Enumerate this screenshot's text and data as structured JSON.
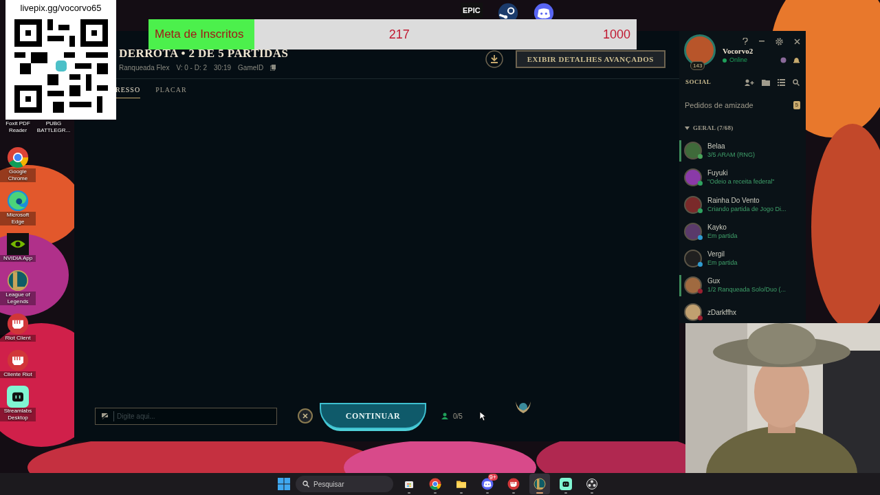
{
  "desktop_icons": [
    {
      "label": "Foxit PDF Reader"
    },
    {
      "label": "PUBG BATTLEGR..."
    },
    {
      "label": "Google Chrome",
      "kind": "chrome"
    },
    {
      "label": "Microsoft Edge",
      "kind": "edge"
    },
    {
      "label": "NVIDIA App",
      "kind": "nvidia"
    },
    {
      "label": "League of Legends",
      "kind": "lol"
    },
    {
      "label": "Riot Client",
      "kind": "riot"
    },
    {
      "label": "Cliente Riot",
      "kind": "riot"
    },
    {
      "label": "Streamlabs Desktop",
      "kind": "streamlabs"
    }
  ],
  "top_icons": [
    {
      "kind": "epic",
      "label": "EPIC"
    },
    {
      "kind": "steam"
    },
    {
      "kind": "discord"
    }
  ],
  "qr_overlay": {
    "url": "livepix.gg/vocorvo65"
  },
  "goal_overlay": {
    "label": "Meta de Inscritos",
    "current": "217",
    "target": "1000",
    "level": 0.217
  },
  "match": {
    "title": "DERROTA • 2 DE 5 PARTIDAS",
    "queue": "Ranqueada Flex",
    "record": "V: 0 - D: 2",
    "duration": "30:19",
    "game_id": "GameID",
    "details_button": "EXIBIR DETALHES AVANÇADOS",
    "tabs": [
      {
        "label": "RESSO",
        "selected": true
      },
      {
        "label": "PLACAR",
        "selected": false
      }
    ],
    "chat_placeholder": "Digite aqui...",
    "continue_button": "CONTINUAR",
    "ready": "0/5"
  },
  "social": {
    "profile": {
      "name": "Vocorvo2",
      "status": "Online",
      "level": "143"
    },
    "title": "SOCIAL",
    "friend_requests": {
      "label": "Pedidos de amizade",
      "count": "5"
    },
    "group": {
      "label": "GERAL (7/68)",
      "expanded": true
    },
    "friends": [
      {
        "name": "Belaa",
        "status": "3/5 ARAM (RNG)",
        "color": "#49a35a",
        "highlighted": true
      },
      {
        "name": "Fuyuki",
        "status": "\"Odeio a receita federal\"",
        "color": "#2fa360",
        "highlighted": false
      },
      {
        "name": "Rainha Do Vento",
        "status": "Criando partida de Jogo Di...",
        "color": "#2fa360",
        "highlighted": false
      },
      {
        "name": "Kayko",
        "status": "Em partida",
        "color": "#2f9bd0",
        "highlighted": false
      },
      {
        "name": "Vergil",
        "status": "Em partida",
        "color": "#2f9bd0",
        "highlighted": false
      },
      {
        "name": "Gux",
        "status": "1/2 Ranqueada Solo/Duo (...",
        "color": "#9a2030",
        "highlighted": true
      },
      {
        "name": "zDarkffhx",
        "color": "#9a2030",
        "highlighted": false
      }
    ]
  },
  "taskbar": {
    "search_placeholder": "Pesquisar",
    "apps": [
      {
        "kind": "store",
        "selected": false
      },
      {
        "kind": "chrome",
        "selected": false
      },
      {
        "kind": "folder",
        "selected": false
      },
      {
        "kind": "discord",
        "selected": false,
        "badge": "9+"
      },
      {
        "kind": "riot",
        "selected": false
      },
      {
        "kind": "lol",
        "selected": true
      },
      {
        "kind": "streamlabs",
        "selected": false
      },
      {
        "kind": "obs",
        "selected": false
      }
    ]
  }
}
